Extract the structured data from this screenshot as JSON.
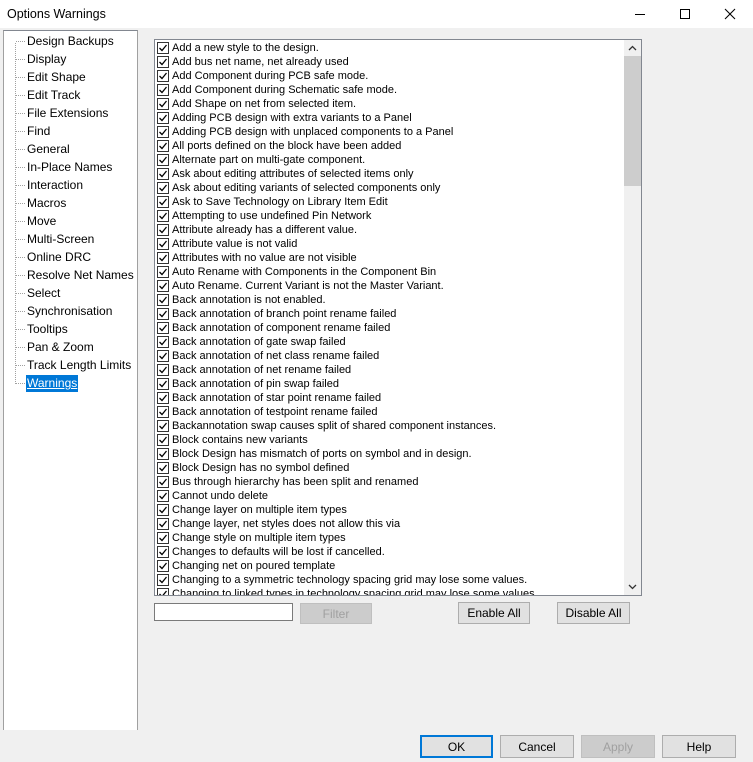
{
  "window": {
    "title": "Options  Warnings",
    "controls": [
      "minimize-icon",
      "maximize-icon",
      "close-icon"
    ]
  },
  "tree": {
    "items": [
      {
        "label": "Design Backups"
      },
      {
        "label": "Display"
      },
      {
        "label": "Edit Shape"
      },
      {
        "label": "Edit Track"
      },
      {
        "label": "File Extensions"
      },
      {
        "label": "Find"
      },
      {
        "label": "General"
      },
      {
        "label": "In-Place Names"
      },
      {
        "label": "Interaction"
      },
      {
        "label": "Macros"
      },
      {
        "label": "Move"
      },
      {
        "label": "Multi-Screen"
      },
      {
        "label": "Online DRC"
      },
      {
        "label": "Resolve Net Names"
      },
      {
        "label": "Select"
      },
      {
        "label": "Synchronisation"
      },
      {
        "label": "Tooltips"
      },
      {
        "label": "Pan & Zoom"
      },
      {
        "label": "Track Length Limits"
      },
      {
        "label": "Warnings",
        "selected": true
      }
    ]
  },
  "warnings": {
    "items": [
      {
        "label": "Add a new style to the design.",
        "checked": true
      },
      {
        "label": "Add bus net name, net already used",
        "checked": true
      },
      {
        "label": "Add Component during PCB safe mode.",
        "checked": true
      },
      {
        "label": "Add Component during Schematic safe mode.",
        "checked": true
      },
      {
        "label": "Add Shape on net from selected item.",
        "checked": true
      },
      {
        "label": "Adding PCB design with extra variants to a Panel",
        "checked": true
      },
      {
        "label": "Adding PCB design with unplaced components to a Panel",
        "checked": true
      },
      {
        "label": "All ports defined on the block have been added",
        "checked": true
      },
      {
        "label": "Alternate part on multi-gate component.",
        "checked": true
      },
      {
        "label": "Ask about editing attributes of selected items only",
        "checked": true
      },
      {
        "label": "Ask about editing variants of selected components only",
        "checked": true
      },
      {
        "label": "Ask to Save Technology on Library Item Edit",
        "checked": true
      },
      {
        "label": "Attempting to use undefined Pin Network",
        "checked": true
      },
      {
        "label": "Attribute already has a different value.",
        "checked": true
      },
      {
        "label": "Attribute value is not valid",
        "checked": true
      },
      {
        "label": "Attributes with no value are not visible",
        "checked": true
      },
      {
        "label": "Auto Rename with Components in the Component Bin",
        "checked": true
      },
      {
        "label": "Auto Rename. Current Variant is not the Master Variant.",
        "checked": true
      },
      {
        "label": "Back annotation is not enabled.",
        "checked": true
      },
      {
        "label": "Back annotation of branch point rename failed",
        "checked": true
      },
      {
        "label": "Back annotation of component rename failed",
        "checked": true
      },
      {
        "label": "Back annotation of gate swap failed",
        "checked": true
      },
      {
        "label": "Back annotation of net class rename failed",
        "checked": true
      },
      {
        "label": "Back annotation of net rename failed",
        "checked": true
      },
      {
        "label": "Back annotation of pin swap failed",
        "checked": true
      },
      {
        "label": "Back annotation of star point rename failed",
        "checked": true
      },
      {
        "label": "Back annotation of testpoint rename failed",
        "checked": true
      },
      {
        "label": "Backannotation swap causes split of shared component instances.",
        "checked": true
      },
      {
        "label": "Block contains new variants",
        "checked": true
      },
      {
        "label": "Block Design has mismatch of ports on symbol and in design.",
        "checked": true
      },
      {
        "label": "Block Design has no symbol defined",
        "checked": true
      },
      {
        "label": "Bus through hierarchy has been split and renamed",
        "checked": true
      },
      {
        "label": "Cannot undo delete",
        "checked": true
      },
      {
        "label": "Change layer on multiple item types",
        "checked": true
      },
      {
        "label": "Change layer, net styles does not allow this via",
        "checked": true
      },
      {
        "label": "Change style on multiple item types",
        "checked": true
      },
      {
        "label": "Changes to defaults will be lost if cancelled.",
        "checked": true
      },
      {
        "label": "Changing net on poured template",
        "checked": true
      },
      {
        "label": "Changing to a symmetric technology spacing grid may lose some values.",
        "checked": true
      },
      {
        "label": "Changing to linked types in technology spacing grid may lose some values.",
        "checked": true
      }
    ]
  },
  "filter": {
    "input_value": "",
    "button_label": "Filter"
  },
  "list_buttons": {
    "enable_all": "Enable All",
    "disable_all": "Disable All"
  },
  "dialog_buttons": {
    "ok": "OK",
    "cancel": "Cancel",
    "apply": "Apply",
    "help": "Help"
  }
}
